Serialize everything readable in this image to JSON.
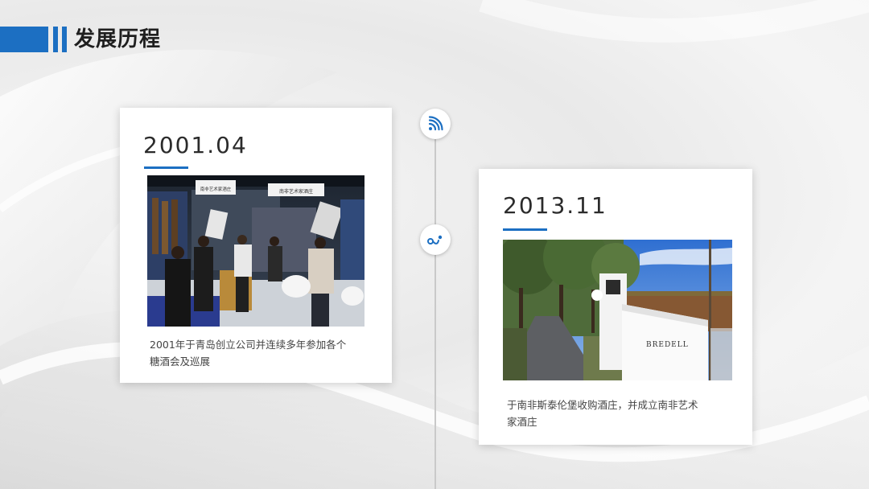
{
  "header": {
    "title": "发展历程"
  },
  "colors": {
    "accent": "#1c6fc2"
  },
  "timeline": {
    "nodes": [
      {
        "icon": "wifi-signal-icon"
      },
      {
        "icon": "link-icon"
      }
    ]
  },
  "events": [
    {
      "date": "2001.04",
      "image": "wine-exhibition-booth-photo",
      "booth_sign_1": "南非艺术家酒庄",
      "booth_sign_2": "南非艺术家酒庄",
      "desc_line1": "2001年于青岛创立公司并连续多年参加各个",
      "desc_line2": "糖酒会及巡展"
    },
    {
      "date": "2013.11",
      "image": "vineyard-estate-sign-photo",
      "sign_text": "BREDELL",
      "desc_line1": "于南非斯泰伦堡收购酒庄，并成立南非艺术",
      "desc_line2": "家酒庄"
    }
  ]
}
